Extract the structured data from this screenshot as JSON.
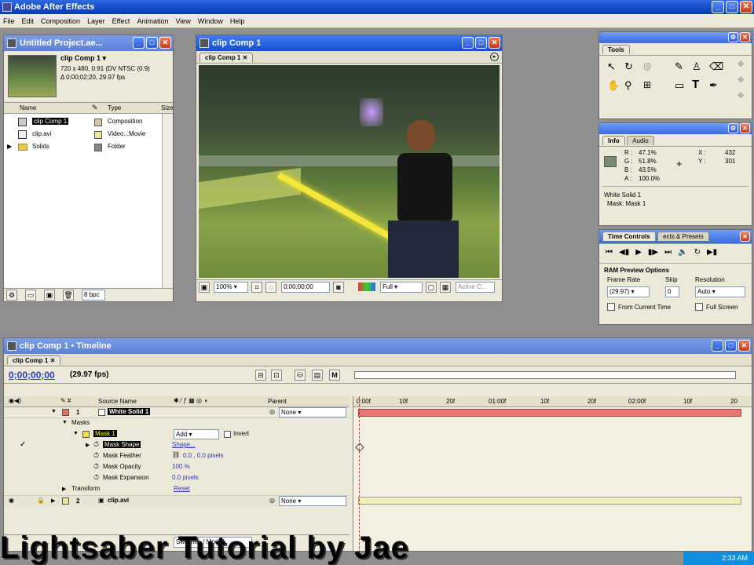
{
  "app": {
    "title": "Adobe After Effects"
  },
  "menu": [
    "File",
    "Edit",
    "Composition",
    "Layer",
    "Effect",
    "Animation",
    "View",
    "Window",
    "Help"
  ],
  "project": {
    "title": "Untitled Project.ae...",
    "comp_name": "clip Comp 1 ▾",
    "comp_info1": "720 x 480, 0.91 (DV NTSC (0.9)",
    "comp_info2": "Δ 0;00;02;20, 29.97 fps",
    "col_name": "Name",
    "col_type": "Type",
    "col_size": "Size",
    "items": [
      {
        "name": "clip Comp 1",
        "type": "Composition",
        "color": "#d4c8a8"
      },
      {
        "name": "clip.avi",
        "type": "Video...Movie",
        "color": "#e8e89a"
      },
      {
        "name": "Solids",
        "type": "Folder",
        "color": "#888888"
      }
    ],
    "bpc": "8 bpc"
  },
  "comp": {
    "title": "clip Comp 1",
    "tab": "clip Comp 1",
    "zoom": "100%",
    "timecode": "0;00;00;00",
    "resolution": "Full",
    "active_camera": "Active C..."
  },
  "tools": {
    "tab": "Tools"
  },
  "info": {
    "tab_info": "Info",
    "tab_audio": "Audio",
    "r": "47.1%",
    "g": "51.8%",
    "b": "43.5%",
    "a": "100.0%",
    "x": "432",
    "y": "301",
    "line1": "White Solid 1",
    "line2": "Mask: Mask 1",
    "swatch": "#7a8a6e"
  },
  "timecontrols": {
    "tab": "Time Controls",
    "tab2": "ects & Presets",
    "ram_title": "RAM Preview Options",
    "frame_rate_label": "Frame Rate",
    "skip_label": "Skip",
    "resolution_label": "Resolution",
    "frame_rate": "(29.97)",
    "skip": "0",
    "resolution": "Auto",
    "from_current": "From Current Time",
    "full_screen": "Full Screen"
  },
  "timeline": {
    "title": "clip Comp 1 • Timeline",
    "tab": "clip Comp 1",
    "timecode": "0;00;00;00",
    "fps": "(29.97 fps)",
    "col_source": "Source Name",
    "col_parent": "Parent",
    "ruler": [
      "0:00f",
      "10f",
      "20f",
      "01:00f",
      "10f",
      "20f",
      "02:00f",
      "10f",
      "20"
    ],
    "layer1": {
      "num": "1",
      "name": "White Solid 1",
      "parent": "None"
    },
    "masks": "Masks",
    "mask1": "Mask 1",
    "mask_mode": "Add",
    "invert": "Invert",
    "props": [
      {
        "name": "Mask Shape",
        "value": "Shape..."
      },
      {
        "name": "Mask Feather",
        "value": "0.0 , 0.0 pixels"
      },
      {
        "name": "Mask Opacity",
        "value": "100 %"
      },
      {
        "name": "Mask Expansion",
        "value": "0.0 pixels"
      }
    ],
    "transform": "Transform",
    "reset": "Reset",
    "layer2": {
      "num": "2",
      "name": "clip.avi",
      "parent": "None"
    },
    "switches": "Switches / Modes"
  },
  "caption": "Lightsaber Tutorial by Jae",
  "clock": "2:33 AM"
}
